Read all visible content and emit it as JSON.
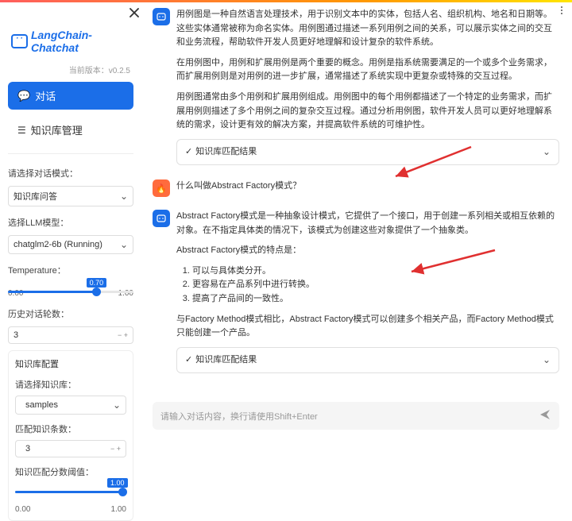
{
  "brand": "LangChain-Chatchat",
  "version_label": "当前版本：",
  "version": "v0.2.5",
  "nav": {
    "chat": "对话",
    "kb": "知识库管理"
  },
  "mode": {
    "label": "请选择对话模式：",
    "value": "知识库问答"
  },
  "llm": {
    "label": "选择LLM模型：",
    "value": "chatglm2-6b (Running)"
  },
  "temperature": {
    "label": "Temperature：",
    "value": "0.70",
    "min": "0.00",
    "max": "1.00",
    "pct": 70
  },
  "history": {
    "label": "历史对话轮数：",
    "value": "3"
  },
  "kb_config": {
    "title": "知识库配置",
    "select_label": "请选择知识库：",
    "select_value": "samples",
    "topk_label": "匹配知识条数：",
    "topk_value": "3",
    "thresh_label": "知识匹配分数阈值：",
    "thresh_value": "1.00",
    "thresh_min": "0.00",
    "thresh_max": "1.00",
    "thresh_pct": 100
  },
  "chat": {
    "ai1_p1": "用例图是一种自然语言处理技术，用于识别文本中的实体，包括人名、组织机构、地名和日期等。这些实体通常被称为命名实体。用例图通过描述一系列用例之间的关系，可以展示实体之间的交互和业务流程，帮助软件开发人员更好地理解和设计复杂的软件系统。",
    "ai1_p2": "在用例图中，用例和扩展用例是两个重要的概念。用例是指系统需要满足的一个或多个业务需求，而扩展用例则是对用例的进一步扩展，通常描述了系统实现中更复杂或特殊的交互过程。",
    "ai1_p3": "用例图通常由多个用例和扩展用例组成。用例图中的每个用例都描述了一个特定的业务需求，而扩展用例则描述了多个用例之间的复杂交互过程。通过分析用例图，软件开发人员可以更好地理解系统的需求，设计更有效的解决方案，并提高软件系统的可维护性。",
    "expander": "知识库匹配结果",
    "user_q": "什么叫做Abstract Factory模式？",
    "ai2_p1": "Abstract Factory模式是一种抽象设计模式，它提供了一个接口，用于创建一系列相关或相互依赖的对象。在不指定具体类的情况下，该模式为创建这些对象提供了一个抽象类。",
    "ai2_p2": "Abstract Factory模式的特点是：",
    "ai2_li1": "可以与具体类分开。",
    "ai2_li2": "更容易在产品系列中进行转换。",
    "ai2_li3": "提高了产品间的一致性。",
    "ai2_p3": "与Factory Method模式相比，Abstract Factory模式可以创建多个相关产品，而Factory Method模式只能创建一个产品。"
  },
  "input_placeholder": "请输入对话内容，换行请使用Shift+Enter"
}
